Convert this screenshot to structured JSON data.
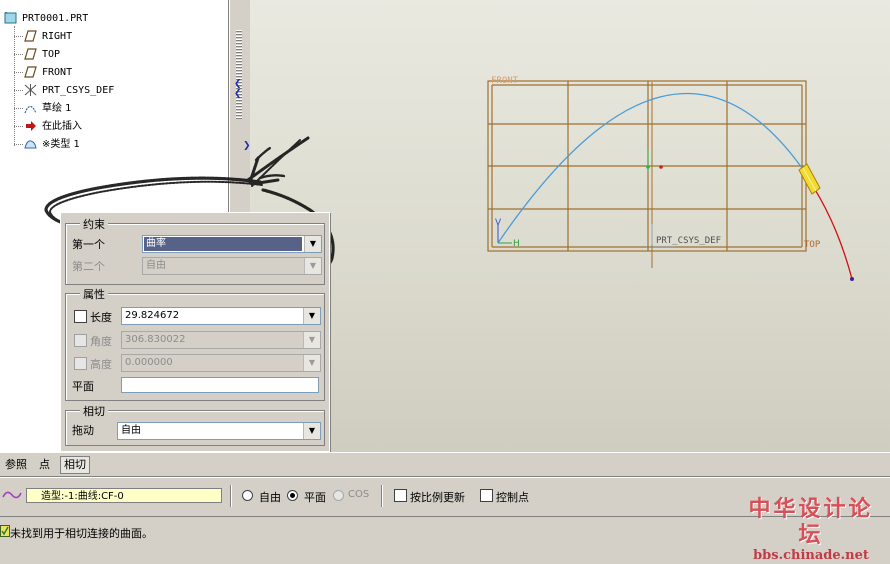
{
  "tree": {
    "root": "PRT0001.PRT",
    "items": [
      {
        "label": "RIGHT",
        "icon": "datum-plane-icon"
      },
      {
        "label": "TOP",
        "icon": "datum-plane-icon"
      },
      {
        "label": "FRONT",
        "icon": "datum-plane-icon"
      },
      {
        "label": "PRT_CSYS_DEF",
        "icon": "coordinate-system-icon"
      },
      {
        "label": "草绘 1",
        "icon": "sketch-icon"
      },
      {
        "label": "在此插入",
        "icon": "insert-here-arrow-icon"
      },
      {
        "label": "※类型 1",
        "icon": "style-feature-icon"
      }
    ]
  },
  "panel": {
    "constraint": {
      "title": "约束",
      "first_label": "第一个",
      "first_value": "曲率",
      "second_label": "第二个",
      "second_value": "自由"
    },
    "properties": {
      "title": "属性",
      "length_label": "长度",
      "length_value": "29.824672",
      "angle_label": "角度",
      "angle_value": "306.830022",
      "height_label": "高度",
      "height_value": "0.000000",
      "plane_label": "平面",
      "plane_value": ""
    },
    "tangent": {
      "title": "相切",
      "drag_label": "拖动",
      "drag_value": "自由"
    }
  },
  "tabs": [
    "参照",
    "点",
    "相切"
  ],
  "dashboard": {
    "curve_field": "造型:-1:曲线:CF-0",
    "radio_free": "自由",
    "radio_plane": "平面",
    "radio_cos": "COS",
    "check_scale": "按比例更新",
    "check_control": "控制点"
  },
  "status": {
    "message": "未找到用于相切连接的曲面。"
  },
  "graphics": {
    "label_front": "FRONT",
    "label_top": "TOP",
    "label_csys": "PRT_CSYS_DEF",
    "axis_v": "V",
    "axis_h": "H",
    "colors": {
      "grid": "#a07030",
      "curve": "#4a9cd8",
      "tangent": "#d01010",
      "handle": "#e0c000"
    }
  },
  "watermark": {
    "cn": "中华设计论坛",
    "url": "bbs.chinade.net"
  }
}
